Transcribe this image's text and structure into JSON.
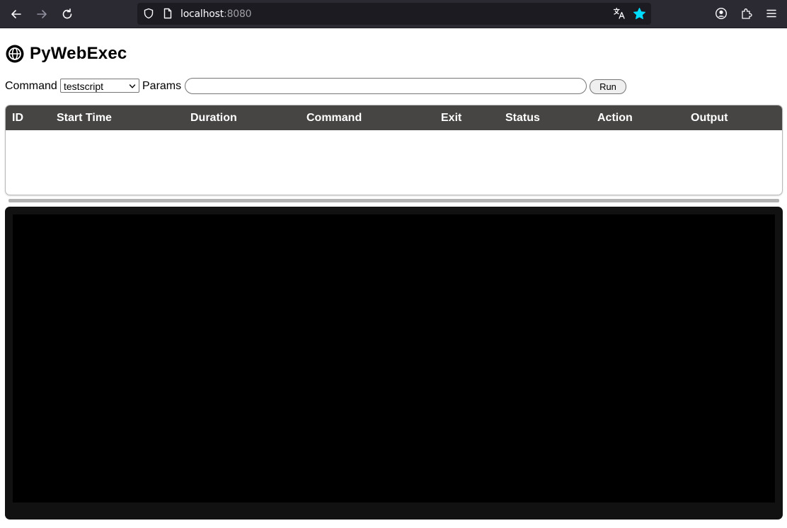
{
  "browser": {
    "url_host": "localhost",
    "url_port": ":8080"
  },
  "page": {
    "title": "PyWebExec"
  },
  "form": {
    "command_label": "Command",
    "command_selected": "testscript",
    "params_label": "Params",
    "params_value": "",
    "run_label": "Run"
  },
  "table": {
    "columns": [
      "ID",
      "Start Time",
      "Duration",
      "Command",
      "Exit",
      "Status",
      "Action",
      "Output"
    ],
    "rows": []
  },
  "colors": {
    "header_bg": "#474543",
    "terminal_bg": "#000000",
    "star_accent": "#00ddff"
  }
}
